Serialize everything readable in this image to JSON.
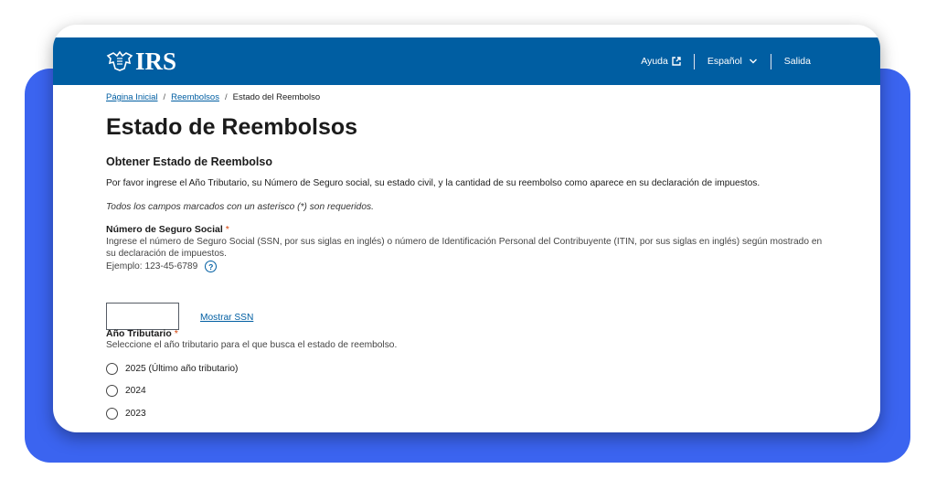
{
  "header": {
    "logo_text": "IRS",
    "nav": {
      "help": "Ayuda",
      "language": "Español",
      "exit": "Salida"
    }
  },
  "breadcrumb": {
    "home": "Página Inicial",
    "refunds": "Reembolsos",
    "current": "Estado del Reembolso",
    "separator": "/"
  },
  "page": {
    "title": "Estado de Reembolsos",
    "section_title": "Obtener Estado de Reembolso",
    "intro": "Por favor ingrese el Año Tributario, su Número de Seguro social, su estado civil, y la cantidad de su reembolso como aparece en su declaración de impuestos.",
    "required_note": "Todos los campos marcados con un asterisco (*) son requeridos."
  },
  "ssn": {
    "label": "Número de Seguro Social",
    "required_mark": "*",
    "hint": "Ingrese el número de Seguro Social (SSN, por sus siglas en inglés) o número de Identificación Personal del Contribuyente (ITIN, por sus siglas en inglés) según mostrado en su declaración de impuestos.",
    "example": "Ejemplo: 123-45-6789",
    "help_symbol": "?",
    "value": "",
    "show_link": "Mostrar SSN"
  },
  "tax_year": {
    "label": "Año Tributario",
    "required_mark": "*",
    "hint": "Seleccione el año tributario para el que busca el estado de reembolso.",
    "options": [
      {
        "label": "2025 (Último año tributario)"
      },
      {
        "label": "2024"
      },
      {
        "label": "2023"
      }
    ]
  },
  "colors": {
    "header_bg": "#005ea2",
    "link": "#005ea2",
    "required": "#d54309",
    "backdrop": "#3b64f0"
  }
}
